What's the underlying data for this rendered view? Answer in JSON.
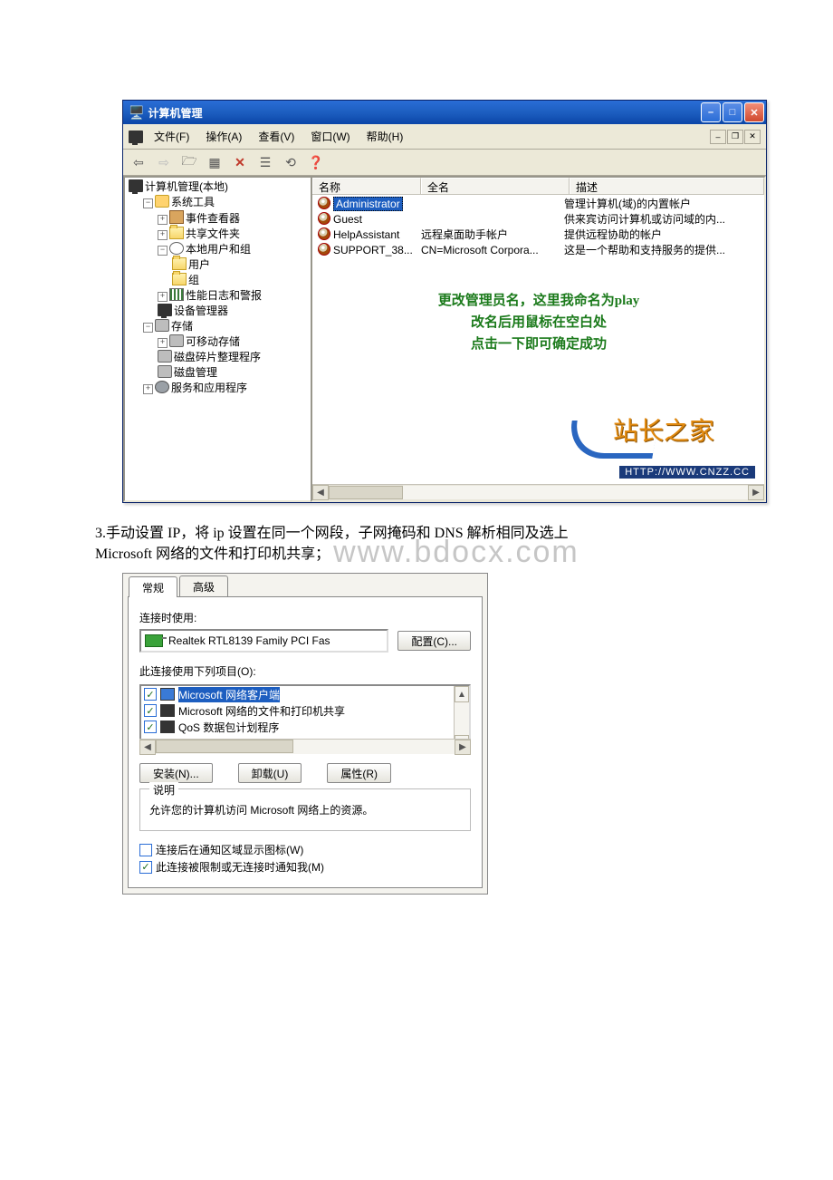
{
  "mgmt": {
    "window_title": "计算机管理",
    "menus": {
      "file": "文件(F)",
      "action": "操作(A)",
      "view": "查看(V)",
      "window": "窗口(W)",
      "help": "帮助(H)"
    },
    "tree": {
      "root": "计算机管理(本地)",
      "sys_tools": "系统工具",
      "event_viewer": "事件查看器",
      "shared_folders": "共享文件夹",
      "local_users": "本地用户和组",
      "users": "用户",
      "groups": "组",
      "perf": "性能日志和警报",
      "device_mgr": "设备管理器",
      "storage": "存储",
      "removable": "可移动存储",
      "defrag": "磁盘碎片整理程序",
      "disk_mgmt": "磁盘管理",
      "services": "服务和应用程序"
    },
    "columns": {
      "name": "名称",
      "fullname": "全名",
      "description": "描述"
    },
    "rows": [
      {
        "name_editing": "Administrator",
        "fullname": "",
        "description": "管理计算机(域)的内置帐户"
      },
      {
        "name": "Guest",
        "fullname": "",
        "description": "供来宾访问计算机或访问域的内..."
      },
      {
        "name": "HelpAssistant",
        "fullname": "远程桌面助手帐户",
        "description": "提供远程协助的帐户"
      },
      {
        "name": "SUPPORT_38...",
        "fullname": "CN=Microsoft Corpora...",
        "description": "这是一个帮助和支持服务的提供..."
      }
    ],
    "annotation": {
      "l1": "更改管理员名，这里我命名为play",
      "l2": "改名后用鼠标在空白处",
      "l3": "点击一下即可确定成功"
    },
    "watermark_brand": "站长之家",
    "watermark_url": "HTTP://WWW.CNZZ.CC"
  },
  "paragraph": {
    "text": "3.手动设置 IP，将 ip 设置在同一个网段，子网掩码和 DNS 解析相同及选上\nMicrosoft 网络的文件和打印机共享；",
    "watermark": "www.bdocx.com"
  },
  "net": {
    "tabs": {
      "general": "常规",
      "advanced": "高级"
    },
    "labels": {
      "connect_using": "连接时使用:",
      "adapter": "Realtek RTL8139 Family PCI Fas",
      "configure_btn": "配置(C)...",
      "uses_items": "此连接使用下列项目(O):",
      "install_btn": "安装(N)...",
      "uninstall_btn": "卸载(U)",
      "properties_btn": "属性(R)",
      "desc_group": "说明",
      "desc_text": "允许您的计算机访问 Microsoft 网络上的资源。",
      "show_icon": "连接后在通知区域显示图标(W)",
      "notify": "此连接被限制或无连接时通知我(M)"
    },
    "components": [
      {
        "checked": true,
        "icon": "client",
        "text": "Microsoft 网络客户端",
        "selected": true
      },
      {
        "checked": true,
        "icon": "service",
        "text": "Microsoft 网络的文件和打印机共享"
      },
      {
        "checked": true,
        "icon": "service",
        "text": "QoS 数据包计划程序"
      }
    ]
  }
}
